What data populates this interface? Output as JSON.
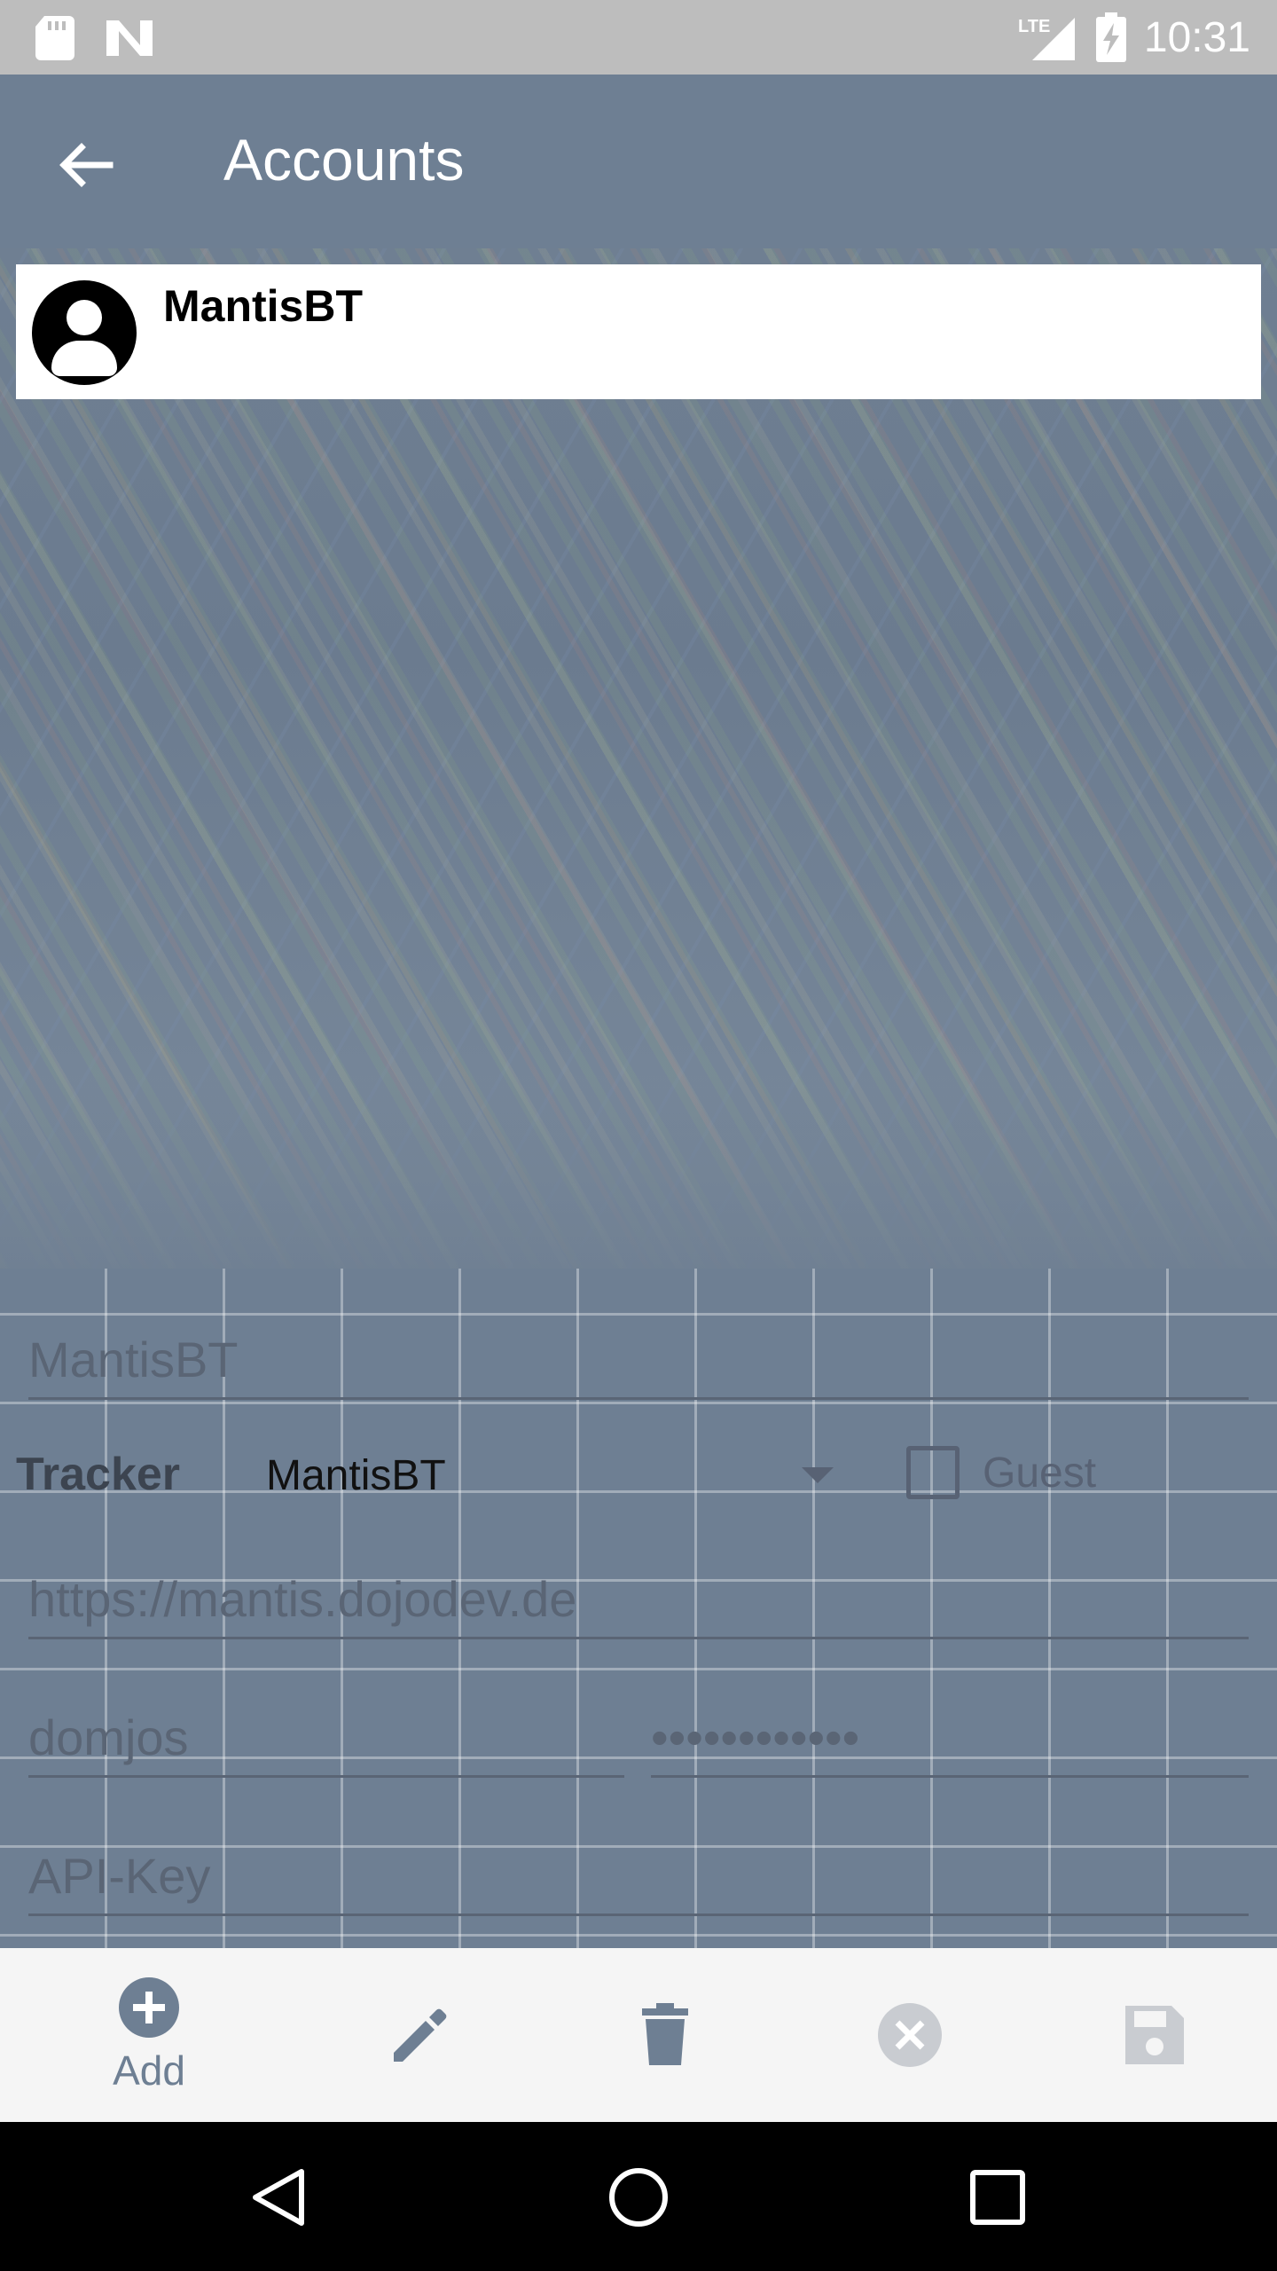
{
  "status_bar": {
    "time": "10:31",
    "network": "LTE",
    "icons": [
      "sd-card-icon",
      "n-icon",
      "lte-signal-icon",
      "battery-charging-icon"
    ]
  },
  "app_bar": {
    "title": "Accounts",
    "back_icon": "arrow-back-icon"
  },
  "accounts": [
    {
      "name": "MantisBT",
      "icon": "account-circle-icon"
    }
  ],
  "form": {
    "account_name": {
      "placeholder": "MantisBT"
    },
    "tracker": {
      "label": "Tracker",
      "selected": "MantisBT"
    },
    "guest": {
      "label": "Guest",
      "checked": false
    },
    "url": {
      "placeholder": "https://mantis.dojodev.de"
    },
    "username": {
      "placeholder": "domjos"
    },
    "password": {
      "placeholder": "••••••••••••"
    },
    "api_key": {
      "placeholder": "API-Key"
    }
  },
  "actions": [
    {
      "label": "Add",
      "icon": "add-circle-icon",
      "enabled": true
    },
    {
      "label": "",
      "icon": "edit-pencil-icon",
      "enabled": true
    },
    {
      "label": "",
      "icon": "delete-trash-icon",
      "enabled": true
    },
    {
      "label": "",
      "icon": "cancel-icon",
      "enabled": false
    },
    {
      "label": "",
      "icon": "save-floppy-icon",
      "enabled": false
    }
  ],
  "colors": {
    "primary": "#6e7f93",
    "status_bar": "#bdbdbd",
    "action_bar_bg": "#f5f5f5"
  }
}
